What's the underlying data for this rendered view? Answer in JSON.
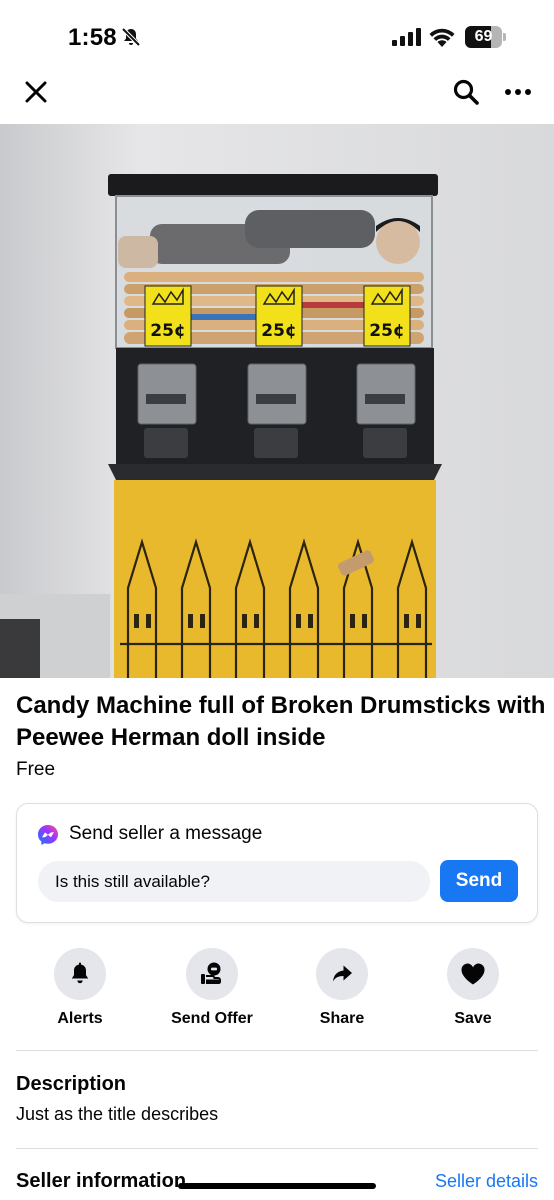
{
  "status_bar": {
    "time": "1:58",
    "battery_level": "69",
    "icons": [
      "bell-slash-icon",
      "cellular-signal-icon",
      "wifi-icon",
      "battery-icon"
    ]
  },
  "nav": {
    "icons": [
      "close-icon",
      "search-icon",
      "more-icon"
    ]
  },
  "listing": {
    "title": "Candy Machine full of Broken Drumsticks with Peewee Herman doll inside",
    "price": "Free",
    "price_tags": [
      "25¢",
      "25¢",
      "25¢"
    ]
  },
  "message_card": {
    "title": "Send seller a message",
    "input_value": "Is this still available?",
    "send_label": "Send",
    "accent_color": "#1877f2"
  },
  "actions": [
    {
      "label": "Alerts",
      "icon": "bell-icon"
    },
    {
      "label": "Send Offer",
      "icon": "offer-icon"
    },
    {
      "label": "Share",
      "icon": "share-icon"
    },
    {
      "label": "Save",
      "icon": "heart-icon"
    }
  ],
  "description": {
    "heading": "Description",
    "text": "Just as the title describes"
  },
  "seller": {
    "heading": "Seller information",
    "link": "Seller details"
  }
}
